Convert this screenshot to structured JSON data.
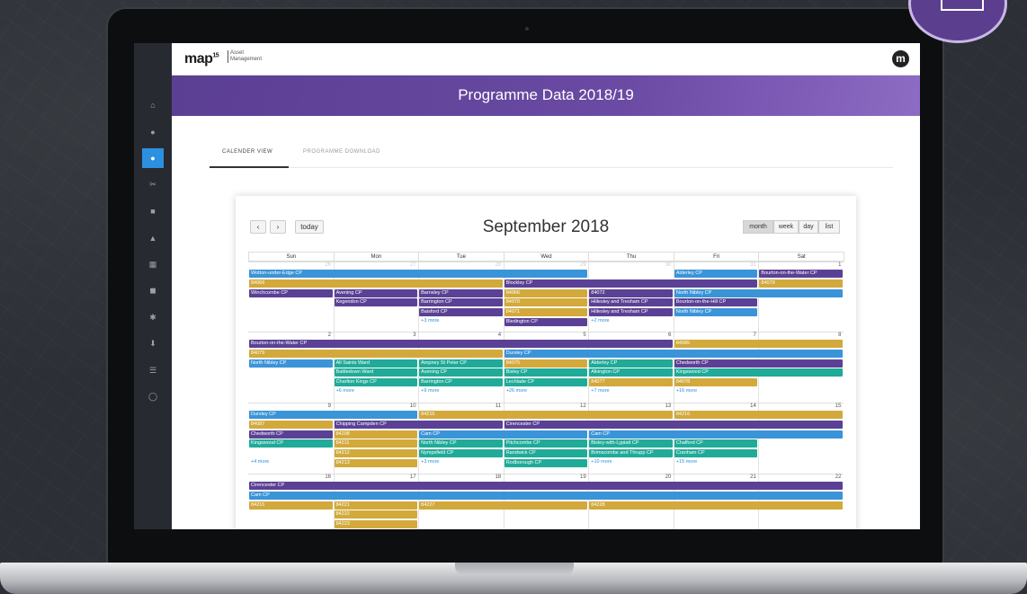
{
  "app": {
    "logo": "map",
    "logo_sup": "15",
    "logo_sub_1": "Asset",
    "logo_sub_2": "Management",
    "user_initial": "m"
  },
  "banner": {
    "title": "Programme Data 2018/19"
  },
  "tabs": [
    {
      "label": "CALENDER VIEW",
      "active": true
    },
    {
      "label": "PROGRAMME DOWNLOAD",
      "active": false
    }
  ],
  "sidebar_icons": [
    "home-icon",
    "user-icon",
    "drop-icon",
    "tools-icon",
    "document-icon",
    "map-icon",
    "calendar-icon",
    "save-icon",
    "settings-icon",
    "download-icon",
    "list-icon",
    "chat-icon"
  ],
  "calendar": {
    "title": "September 2018",
    "prev_label": "‹",
    "next_label": "›",
    "today_label": "today",
    "views": [
      "month",
      "week",
      "day",
      "list"
    ],
    "active_view": "month",
    "days_of_week": [
      "Sun",
      "Mon",
      "Tue",
      "Wed",
      "Thu",
      "Fri",
      "Sat"
    ],
    "weeks": [
      {
        "days": [
          "26",
          "27",
          "28",
          "29",
          "30",
          "31",
          "1"
        ],
        "other_month_days": 6
      },
      {
        "days": [
          "2",
          "3",
          "4",
          "5",
          "6",
          "7",
          "8"
        ],
        "other_month_days": 0
      },
      {
        "days": [
          "9",
          "10",
          "11",
          "12",
          "13",
          "14",
          "15"
        ],
        "other_month_days": 0
      },
      {
        "days": [
          "16",
          "17",
          "18",
          "19",
          "20",
          "21",
          "22"
        ],
        "other_month_days": 0
      }
    ]
  },
  "colors": {
    "blue": "#3a94d8",
    "purple": "#5b4195",
    "gold": "#d2a93a",
    "teal": "#1fab98"
  },
  "events": [
    {
      "week": 0,
      "row": 0,
      "start": 0,
      "span": 4,
      "color": "blue",
      "label": "Wotton-under-Edge CP"
    },
    {
      "week": 0,
      "row": 0,
      "start": 5,
      "span": 1,
      "color": "blue",
      "label": "Alderley CP"
    },
    {
      "week": 0,
      "row": 0,
      "start": 6,
      "span": 1,
      "color": "purple",
      "label": "Bourton-on-the-Water CP"
    },
    {
      "week": 0,
      "row": 1,
      "start": 0,
      "span": 3,
      "color": "gold",
      "label": "84066"
    },
    {
      "week": 0,
      "row": 1,
      "start": 3,
      "span": 3,
      "color": "purple",
      "label": "Blockley CP"
    },
    {
      "week": 0,
      "row": 1,
      "start": 6,
      "span": 1,
      "color": "gold",
      "label": "84079"
    },
    {
      "week": 0,
      "row": 2,
      "start": 0,
      "span": 1,
      "color": "purple",
      "label": "Winchcombe CP"
    },
    {
      "week": 0,
      "row": 2,
      "start": 1,
      "span": 1,
      "color": "purple",
      "label": "Avening CP"
    },
    {
      "week": 0,
      "row": 2,
      "start": 2,
      "span": 1,
      "color": "purple",
      "label": "Barnsley CP"
    },
    {
      "week": 0,
      "row": 2,
      "start": 3,
      "span": 1,
      "color": "gold",
      "label": "84066"
    },
    {
      "week": 0,
      "row": 2,
      "start": 4,
      "span": 1,
      "color": "purple",
      "label": "84072"
    },
    {
      "week": 0,
      "row": 2,
      "start": 5,
      "span": 2,
      "color": "blue",
      "label": "North Nibley CP"
    },
    {
      "week": 0,
      "row": 3,
      "start": 1,
      "span": 1,
      "color": "purple",
      "label": "Kegendon CP"
    },
    {
      "week": 0,
      "row": 3,
      "start": 2,
      "span": 1,
      "color": "purple",
      "label": "Barrington CP"
    },
    {
      "week": 0,
      "row": 3,
      "start": 3,
      "span": 1,
      "color": "gold",
      "label": "84070"
    },
    {
      "week": 0,
      "row": 3,
      "start": 4,
      "span": 1,
      "color": "purple",
      "label": "Hillesley and Tresham CP"
    },
    {
      "week": 0,
      "row": 3,
      "start": 5,
      "span": 1,
      "color": "purple",
      "label": "Bourton-on-the-Hill CP"
    },
    {
      "week": 0,
      "row": 4,
      "start": 2,
      "span": 1,
      "color": "purple",
      "label": "Baisford CP"
    },
    {
      "week": 0,
      "row": 4,
      "start": 3,
      "span": 1,
      "color": "gold",
      "label": "84071"
    },
    {
      "week": 0,
      "row": 4,
      "start": 4,
      "span": 1,
      "color": "purple",
      "label": "Hillesley and Tresham CP"
    },
    {
      "week": 0,
      "row": 4,
      "start": 5,
      "span": 1,
      "color": "blue",
      "label": "North Nibley CP"
    },
    {
      "week": 0,
      "row": 5,
      "start": 3,
      "span": 1,
      "color": "purple",
      "label": "Bledington CP"
    },
    {
      "week": 1,
      "row": 0,
      "start": 0,
      "span": 5,
      "color": "purple",
      "label": "Bourton-on-the-Water CP"
    },
    {
      "week": 1,
      "row": 0,
      "start": 5,
      "span": 2,
      "color": "gold",
      "label": "84085"
    },
    {
      "week": 1,
      "row": 1,
      "start": 0,
      "span": 3,
      "color": "gold",
      "label": "84079"
    },
    {
      "week": 1,
      "row": 1,
      "start": 3,
      "span": 4,
      "color": "blue",
      "label": "Dursley CP"
    },
    {
      "week": 1,
      "row": 2,
      "start": 0,
      "span": 1,
      "color": "blue",
      "label": "North Nibley CP"
    },
    {
      "week": 1,
      "row": 2,
      "start": 1,
      "span": 1,
      "color": "teal",
      "label": "All Saints Ward"
    },
    {
      "week": 1,
      "row": 2,
      "start": 2,
      "span": 1,
      "color": "teal",
      "label": "Ampney St Peter CP"
    },
    {
      "week": 1,
      "row": 2,
      "start": 3,
      "span": 1,
      "color": "gold",
      "label": "84075"
    },
    {
      "week": 1,
      "row": 2,
      "start": 4,
      "span": 1,
      "color": "teal",
      "label": "Alderley CP"
    },
    {
      "week": 1,
      "row": 2,
      "start": 5,
      "span": 2,
      "color": "purple",
      "label": "Chedworth CP"
    },
    {
      "week": 1,
      "row": 3,
      "start": 1,
      "span": 1,
      "color": "teal",
      "label": "Battledown Ward"
    },
    {
      "week": 1,
      "row": 3,
      "start": 2,
      "span": 1,
      "color": "teal",
      "label": "Avening CP"
    },
    {
      "week": 1,
      "row": 3,
      "start": 3,
      "span": 1,
      "color": "teal",
      "label": "Bisley CP"
    },
    {
      "week": 1,
      "row": 3,
      "start": 4,
      "span": 1,
      "color": "teal",
      "label": "Alkington CP"
    },
    {
      "week": 1,
      "row": 3,
      "start": 5,
      "span": 2,
      "color": "teal",
      "label": "Kingswood CP"
    },
    {
      "week": 1,
      "row": 4,
      "start": 1,
      "span": 1,
      "color": "teal",
      "label": "Charlton Kings CP"
    },
    {
      "week": 1,
      "row": 4,
      "start": 2,
      "span": 1,
      "color": "teal",
      "label": "Barrington CP"
    },
    {
      "week": 1,
      "row": 4,
      "start": 3,
      "span": 1,
      "color": "teal",
      "label": "Lechlade CP"
    },
    {
      "week": 1,
      "row": 4,
      "start": 4,
      "span": 1,
      "color": "gold",
      "label": "84077"
    },
    {
      "week": 1,
      "row": 4,
      "start": 5,
      "span": 1,
      "color": "gold",
      "label": "84078"
    },
    {
      "week": 2,
      "row": 0,
      "start": 0,
      "span": 2,
      "color": "blue",
      "label": "Dursley CP"
    },
    {
      "week": 2,
      "row": 0,
      "start": 2,
      "span": 3,
      "color": "gold",
      "label": "84215"
    },
    {
      "week": 2,
      "row": 0,
      "start": 5,
      "span": 2,
      "color": "gold",
      "label": "84216"
    },
    {
      "week": 2,
      "row": 1,
      "start": 0,
      "span": 1,
      "color": "gold",
      "label": "84087"
    },
    {
      "week": 2,
      "row": 1,
      "start": 1,
      "span": 2,
      "color": "purple",
      "label": "Chipping Campden CP"
    },
    {
      "week": 2,
      "row": 1,
      "start": 3,
      "span": 4,
      "color": "purple",
      "label": "Cirencester CP"
    },
    {
      "week": 2,
      "row": 2,
      "start": 0,
      "span": 1,
      "color": "purple",
      "label": "Chedworth CP"
    },
    {
      "week": 2,
      "row": 2,
      "start": 1,
      "span": 1,
      "color": "gold",
      "label": "84208"
    },
    {
      "week": 2,
      "row": 2,
      "start": 2,
      "span": 2,
      "color": "blue",
      "label": "Cam CP"
    },
    {
      "week": 2,
      "row": 2,
      "start": 4,
      "span": 3,
      "color": "blue",
      "label": "Cam CP"
    },
    {
      "week": 2,
      "row": 3,
      "start": 0,
      "span": 1,
      "color": "teal",
      "label": "Kingswood CP"
    },
    {
      "week": 2,
      "row": 3,
      "start": 1,
      "span": 1,
      "color": "gold",
      "label": "84211"
    },
    {
      "week": 2,
      "row": 3,
      "start": 2,
      "span": 1,
      "color": "teal",
      "label": "North Nibley CP"
    },
    {
      "week": 2,
      "row": 3,
      "start": 3,
      "span": 1,
      "color": "teal",
      "label": "Pitchcombe CP"
    },
    {
      "week": 2,
      "row": 3,
      "start": 4,
      "span": 1,
      "color": "teal",
      "label": "Bisley-with-Lypiatt CP"
    },
    {
      "week": 2,
      "row": 3,
      "start": 5,
      "span": 1,
      "color": "teal",
      "label": "Chalford CP"
    },
    {
      "week": 2,
      "row": 4,
      "start": 1,
      "span": 1,
      "color": "gold",
      "label": "84212"
    },
    {
      "week": 2,
      "row": 4,
      "start": 2,
      "span": 1,
      "color": "teal",
      "label": "Nympsfield CP"
    },
    {
      "week": 2,
      "row": 4,
      "start": 3,
      "span": 1,
      "color": "teal",
      "label": "Randwick CP"
    },
    {
      "week": 2,
      "row": 4,
      "start": 4,
      "span": 1,
      "color": "teal",
      "label": "Brimscombe and Thrupp CP"
    },
    {
      "week": 2,
      "row": 4,
      "start": 5,
      "span": 1,
      "color": "teal",
      "label": "Cranham CP"
    },
    {
      "week": 2,
      "row": 5,
      "start": 1,
      "span": 1,
      "color": "gold",
      "label": "84213"
    },
    {
      "week": 2,
      "row": 5,
      "start": 3,
      "span": 1,
      "color": "teal",
      "label": "Rodborough CP"
    },
    {
      "week": 3,
      "row": 0,
      "start": 0,
      "span": 7,
      "color": "purple",
      "label": "Cirencester CP"
    },
    {
      "week": 3,
      "row": 1,
      "start": 0,
      "span": 7,
      "color": "blue",
      "label": "Cam CP"
    },
    {
      "week": 3,
      "row": 2,
      "start": 0,
      "span": 1,
      "color": "gold",
      "label": "84216"
    },
    {
      "week": 3,
      "row": 2,
      "start": 1,
      "span": 1,
      "color": "gold",
      "label": "84221"
    },
    {
      "week": 3,
      "row": 2,
      "start": 2,
      "span": 2,
      "color": "gold",
      "label": "84227"
    },
    {
      "week": 3,
      "row": 2,
      "start": 4,
      "span": 3,
      "color": "gold",
      "label": "84228"
    },
    {
      "week": 3,
      "row": 3,
      "start": 1,
      "span": 1,
      "color": "gold",
      "label": "84222"
    },
    {
      "week": 3,
      "row": 4,
      "start": 1,
      "span": 1,
      "color": "gold",
      "label": "84223"
    }
  ],
  "more_links": [
    {
      "week": 0,
      "row": 5,
      "col": 2,
      "label": "+3 more"
    },
    {
      "week": 0,
      "row": 5,
      "col": 4,
      "label": "+2 more"
    },
    {
      "week": 1,
      "row": 5,
      "col": 1,
      "label": "+6 more"
    },
    {
      "week": 1,
      "row": 5,
      "col": 2,
      "label": "+9 more"
    },
    {
      "week": 1,
      "row": 5,
      "col": 3,
      "label": "+26 more"
    },
    {
      "week": 1,
      "row": 5,
      "col": 4,
      "label": "+7 more"
    },
    {
      "week": 1,
      "row": 5,
      "col": 5,
      "label": "+16 more"
    },
    {
      "week": 2,
      "row": 5,
      "col": 0,
      "label": "+4 more"
    },
    {
      "week": 2,
      "row": 5,
      "col": 2,
      "label": "+3 more"
    },
    {
      "week": 2,
      "row": 5,
      "col": 4,
      "label": "+10 more"
    },
    {
      "week": 2,
      "row": 5,
      "col": 5,
      "label": "+15 more"
    }
  ]
}
